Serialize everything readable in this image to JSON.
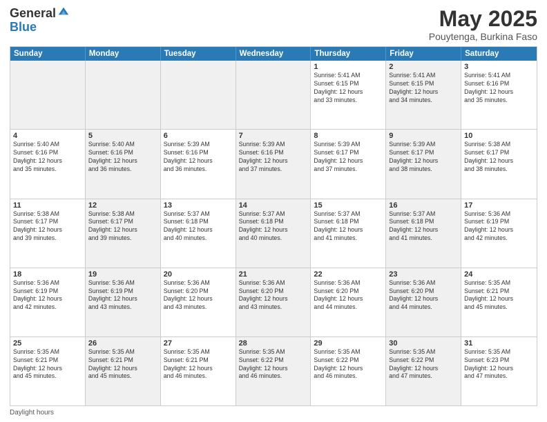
{
  "header": {
    "logo_general": "General",
    "logo_blue": "Blue",
    "title": "May 2025",
    "location": "Pouytenga, Burkina Faso"
  },
  "weekdays": [
    "Sunday",
    "Monday",
    "Tuesday",
    "Wednesday",
    "Thursday",
    "Friday",
    "Saturday"
  ],
  "weeks": [
    [
      {
        "day": "",
        "info": "",
        "shaded": true
      },
      {
        "day": "",
        "info": "",
        "shaded": true
      },
      {
        "day": "",
        "info": "",
        "shaded": true
      },
      {
        "day": "",
        "info": "",
        "shaded": true
      },
      {
        "day": "1",
        "info": "Sunrise: 5:41 AM\nSunset: 6:15 PM\nDaylight: 12 hours\nand 33 minutes.",
        "shaded": false
      },
      {
        "day": "2",
        "info": "Sunrise: 5:41 AM\nSunset: 6:15 PM\nDaylight: 12 hours\nand 34 minutes.",
        "shaded": true
      },
      {
        "day": "3",
        "info": "Sunrise: 5:41 AM\nSunset: 6:16 PM\nDaylight: 12 hours\nand 35 minutes.",
        "shaded": false
      }
    ],
    [
      {
        "day": "4",
        "info": "Sunrise: 5:40 AM\nSunset: 6:16 PM\nDaylight: 12 hours\nand 35 minutes.",
        "shaded": false
      },
      {
        "day": "5",
        "info": "Sunrise: 5:40 AM\nSunset: 6:16 PM\nDaylight: 12 hours\nand 36 minutes.",
        "shaded": true
      },
      {
        "day": "6",
        "info": "Sunrise: 5:39 AM\nSunset: 6:16 PM\nDaylight: 12 hours\nand 36 minutes.",
        "shaded": false
      },
      {
        "day": "7",
        "info": "Sunrise: 5:39 AM\nSunset: 6:16 PM\nDaylight: 12 hours\nand 37 minutes.",
        "shaded": true
      },
      {
        "day": "8",
        "info": "Sunrise: 5:39 AM\nSunset: 6:17 PM\nDaylight: 12 hours\nand 37 minutes.",
        "shaded": false
      },
      {
        "day": "9",
        "info": "Sunrise: 5:39 AM\nSunset: 6:17 PM\nDaylight: 12 hours\nand 38 minutes.",
        "shaded": true
      },
      {
        "day": "10",
        "info": "Sunrise: 5:38 AM\nSunset: 6:17 PM\nDaylight: 12 hours\nand 38 minutes.",
        "shaded": false
      }
    ],
    [
      {
        "day": "11",
        "info": "Sunrise: 5:38 AM\nSunset: 6:17 PM\nDaylight: 12 hours\nand 39 minutes.",
        "shaded": false
      },
      {
        "day": "12",
        "info": "Sunrise: 5:38 AM\nSunset: 6:17 PM\nDaylight: 12 hours\nand 39 minutes.",
        "shaded": true
      },
      {
        "day": "13",
        "info": "Sunrise: 5:37 AM\nSunset: 6:18 PM\nDaylight: 12 hours\nand 40 minutes.",
        "shaded": false
      },
      {
        "day": "14",
        "info": "Sunrise: 5:37 AM\nSunset: 6:18 PM\nDaylight: 12 hours\nand 40 minutes.",
        "shaded": true
      },
      {
        "day": "15",
        "info": "Sunrise: 5:37 AM\nSunset: 6:18 PM\nDaylight: 12 hours\nand 41 minutes.",
        "shaded": false
      },
      {
        "day": "16",
        "info": "Sunrise: 5:37 AM\nSunset: 6:18 PM\nDaylight: 12 hours\nand 41 minutes.",
        "shaded": true
      },
      {
        "day": "17",
        "info": "Sunrise: 5:36 AM\nSunset: 6:19 PM\nDaylight: 12 hours\nand 42 minutes.",
        "shaded": false
      }
    ],
    [
      {
        "day": "18",
        "info": "Sunrise: 5:36 AM\nSunset: 6:19 PM\nDaylight: 12 hours\nand 42 minutes.",
        "shaded": false
      },
      {
        "day": "19",
        "info": "Sunrise: 5:36 AM\nSunset: 6:19 PM\nDaylight: 12 hours\nand 43 minutes.",
        "shaded": true
      },
      {
        "day": "20",
        "info": "Sunrise: 5:36 AM\nSunset: 6:20 PM\nDaylight: 12 hours\nand 43 minutes.",
        "shaded": false
      },
      {
        "day": "21",
        "info": "Sunrise: 5:36 AM\nSunset: 6:20 PM\nDaylight: 12 hours\nand 43 minutes.",
        "shaded": true
      },
      {
        "day": "22",
        "info": "Sunrise: 5:36 AM\nSunset: 6:20 PM\nDaylight: 12 hours\nand 44 minutes.",
        "shaded": false
      },
      {
        "day": "23",
        "info": "Sunrise: 5:36 AM\nSunset: 6:20 PM\nDaylight: 12 hours\nand 44 minutes.",
        "shaded": true
      },
      {
        "day": "24",
        "info": "Sunrise: 5:35 AM\nSunset: 6:21 PM\nDaylight: 12 hours\nand 45 minutes.",
        "shaded": false
      }
    ],
    [
      {
        "day": "25",
        "info": "Sunrise: 5:35 AM\nSunset: 6:21 PM\nDaylight: 12 hours\nand 45 minutes.",
        "shaded": false
      },
      {
        "day": "26",
        "info": "Sunrise: 5:35 AM\nSunset: 6:21 PM\nDaylight: 12 hours\nand 45 minutes.",
        "shaded": true
      },
      {
        "day": "27",
        "info": "Sunrise: 5:35 AM\nSunset: 6:21 PM\nDaylight: 12 hours\nand 46 minutes.",
        "shaded": false
      },
      {
        "day": "28",
        "info": "Sunrise: 5:35 AM\nSunset: 6:22 PM\nDaylight: 12 hours\nand 46 minutes.",
        "shaded": true
      },
      {
        "day": "29",
        "info": "Sunrise: 5:35 AM\nSunset: 6:22 PM\nDaylight: 12 hours\nand 46 minutes.",
        "shaded": false
      },
      {
        "day": "30",
        "info": "Sunrise: 5:35 AM\nSunset: 6:22 PM\nDaylight: 12 hours\nand 47 minutes.",
        "shaded": true
      },
      {
        "day": "31",
        "info": "Sunrise: 5:35 AM\nSunset: 6:23 PM\nDaylight: 12 hours\nand 47 minutes.",
        "shaded": false
      }
    ]
  ],
  "footer": "Daylight hours"
}
